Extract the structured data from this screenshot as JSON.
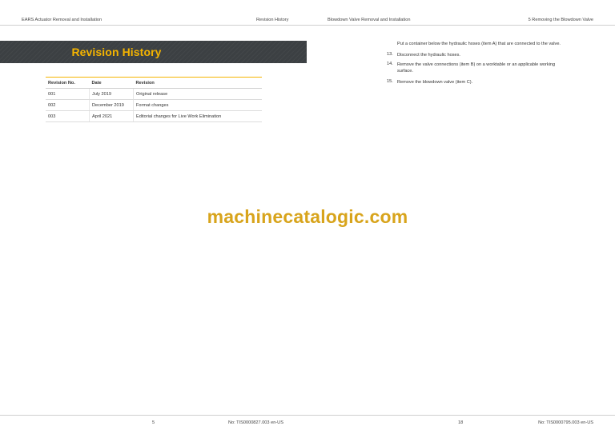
{
  "header": {
    "left_title": "EARS Actuator Removal and Installation",
    "left_section": "Revision History",
    "right_title": "Blowdown Valve Removal and Installation",
    "right_section": "5 Removing the Blowdown Valve"
  },
  "revision_history": {
    "heading": "Revision History",
    "columns": [
      "Revision No.",
      "Date",
      "Revision"
    ],
    "rows": [
      [
        "001",
        "July 2019",
        "Original release"
      ],
      [
        "002",
        "December 2019",
        "Format changes"
      ],
      [
        "003",
        "April 2021",
        "Editorial changes for Live Work Elimination"
      ]
    ]
  },
  "procedure": {
    "intro": "Put a container below the hydraulic hoses (item A) that are connected to the valve.",
    "steps": [
      {
        "num": "13.",
        "text": "Disconnect the hydraulic hoses."
      },
      {
        "num": "14.",
        "text": "Remove the valve connections (item B) on a worktable or an applicable working surface."
      },
      {
        "num": "15.",
        "text": "Remove the blowdown valve (item C)."
      }
    ]
  },
  "watermark": "machinecatalogic.com",
  "footer": {
    "left_page": "5",
    "left_doc": "No: TIS0000827.003 en-US",
    "right_page": "18",
    "right_doc": "No: TIS0000795.003 en-US"
  },
  "colors": {
    "accent": "#f5b400",
    "banner": "#3c4043",
    "watermark": "#d8a41c"
  }
}
